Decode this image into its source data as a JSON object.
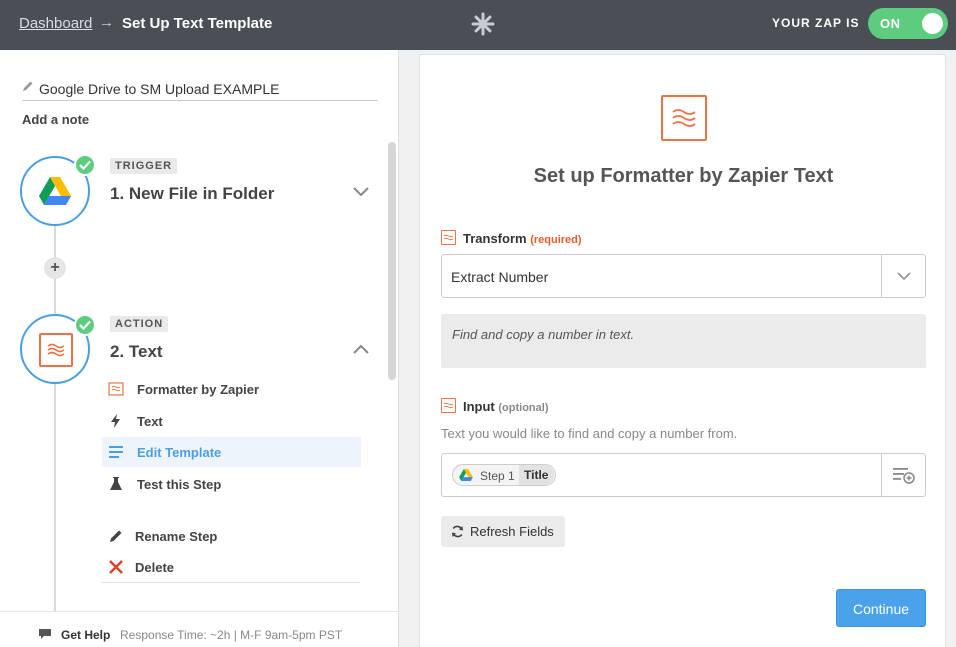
{
  "topbar": {
    "breadcrumb_link": "Dashboard",
    "breadcrumb_arrow": "→",
    "breadcrumb_current": "Set Up Text Template",
    "zap_status_label": "YOUR ZAP IS",
    "toggle_label": "ON"
  },
  "sidebar": {
    "zap_name": "Google Drive to SM Upload EXAMPLE",
    "add_note": "Add a note",
    "steps": [
      {
        "badge": "TRIGGER",
        "title": "1. New File in Folder"
      },
      {
        "badge": "ACTION",
        "title": "2. Text"
      }
    ],
    "add_step": "+",
    "menu": [
      {
        "label": "Formatter by Zapier",
        "icon": "formatter-icon"
      },
      {
        "label": "Text",
        "icon": "bolt-icon"
      },
      {
        "label": "Edit Template",
        "icon": "list-icon"
      },
      {
        "label": "Test this Step",
        "icon": "flask-icon"
      },
      {
        "label": "Rename Step",
        "icon": "pencil-icon"
      },
      {
        "label": "Delete",
        "icon": "close-icon"
      }
    ],
    "help": {
      "label": "Get Help",
      "detail": "Response Time: ~2h | M-F 9am-5pm PST"
    }
  },
  "main": {
    "title": "Set up Formatter by Zapier Text",
    "transform": {
      "label": "Transform",
      "required": "(required)",
      "value": "Extract Number",
      "help": "Find and copy a number in text."
    },
    "input": {
      "label": "Input",
      "optional": "(optional)",
      "description": "Text you would like to find and copy a number from.",
      "pill_step": "Step 1",
      "pill_field": "Title"
    },
    "refresh_label": "Refresh Fields",
    "continue_label": "Continue"
  },
  "colors": {
    "topbar": "#4a4f55",
    "accent_blue": "#4a9fe2",
    "success_green": "#5dcc7f",
    "formatter_orange": "#ef7244"
  }
}
